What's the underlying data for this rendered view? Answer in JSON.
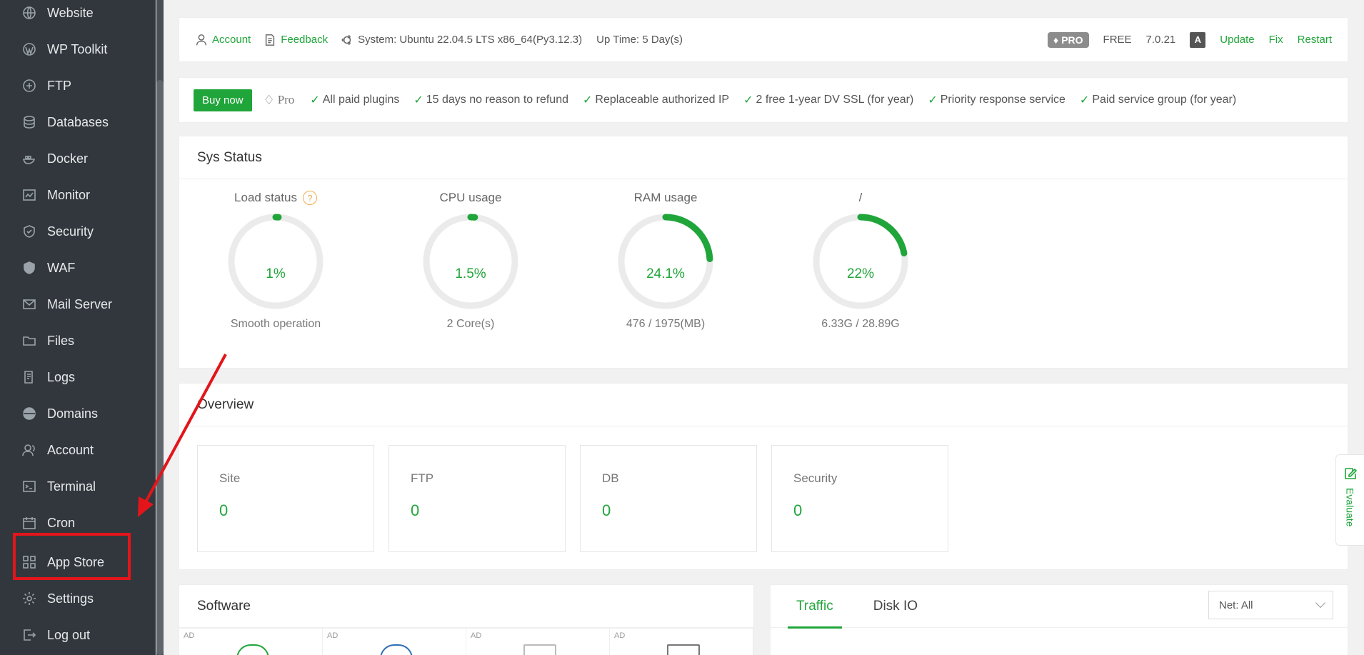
{
  "sidebar": {
    "items": [
      {
        "label": "Website",
        "icon": "globe-icon"
      },
      {
        "label": "WP Toolkit",
        "icon": "wordpress-icon"
      },
      {
        "label": "FTP",
        "icon": "ftp-icon"
      },
      {
        "label": "Databases",
        "icon": "database-icon"
      },
      {
        "label": "Docker",
        "icon": "docker-icon"
      },
      {
        "label": "Monitor",
        "icon": "monitor-icon"
      },
      {
        "label": "Security",
        "icon": "shield-icon"
      },
      {
        "label": "WAF",
        "icon": "waf-shield-icon"
      },
      {
        "label": "Mail Server",
        "icon": "mail-icon"
      },
      {
        "label": "Files",
        "icon": "folder-icon"
      },
      {
        "label": "Logs",
        "icon": "log-icon"
      },
      {
        "label": "Domains",
        "icon": "domain-icon"
      },
      {
        "label": "Account",
        "icon": "user-icon"
      },
      {
        "label": "Terminal",
        "icon": "terminal-icon"
      },
      {
        "label": "Cron",
        "icon": "calendar-icon"
      },
      {
        "label": "App Store",
        "icon": "grid-icon"
      },
      {
        "label": "Settings",
        "icon": "gear-icon"
      },
      {
        "label": "Log out",
        "icon": "logout-icon"
      }
    ]
  },
  "topbar": {
    "account": "Account",
    "feedback": "Feedback",
    "system": "System: Ubuntu 22.04.5 LTS x86_64(Py3.12.3)",
    "uptime": "Up Time: 5 Day(s)",
    "pro_badge": "PRO",
    "edition": "FREE",
    "version": "7.0.21",
    "lang_icon": "A",
    "update": "Update",
    "fix": "Fix",
    "restart": "Restart"
  },
  "buybar": {
    "buy_now": "Buy now",
    "pro": "Pro",
    "features": [
      "All paid plugins",
      "15 days no reason to refund",
      "Replaceable authorized IP",
      "2 free 1-year DV SSL (for year)",
      "Priority response service",
      "Paid service group (for year)"
    ]
  },
  "sys_status": {
    "title": "Sys Status",
    "gauges": [
      {
        "label": "Load status",
        "value": "1%",
        "percent": 1,
        "sub": "Smooth operation",
        "help": "?"
      },
      {
        "label": "CPU usage",
        "value": "1.5%",
        "percent": 1.5,
        "sub": "2 Core(s)"
      },
      {
        "label": "RAM usage",
        "value": "24.1%",
        "percent": 24.1,
        "sub": "476 / 1975(MB)"
      },
      {
        "label": "/",
        "value": "22%",
        "percent": 22,
        "sub": "6.33G / 28.89G"
      }
    ]
  },
  "overview": {
    "title": "Overview",
    "cards": [
      {
        "label": "Site",
        "value": "0"
      },
      {
        "label": "FTP",
        "value": "0"
      },
      {
        "label": "DB",
        "value": "0"
      },
      {
        "label": "Security",
        "value": "0"
      }
    ]
  },
  "software": {
    "title": "Software",
    "ad_label": "AD"
  },
  "traffic": {
    "tabs": [
      "Traffic",
      "Disk IO"
    ],
    "net_select": "Net: All"
  },
  "evaluate": "Evaluate",
  "colors": {
    "accent": "#20a53a",
    "sidebar_bg": "#31373d",
    "annotation_red": "#e3151a"
  }
}
